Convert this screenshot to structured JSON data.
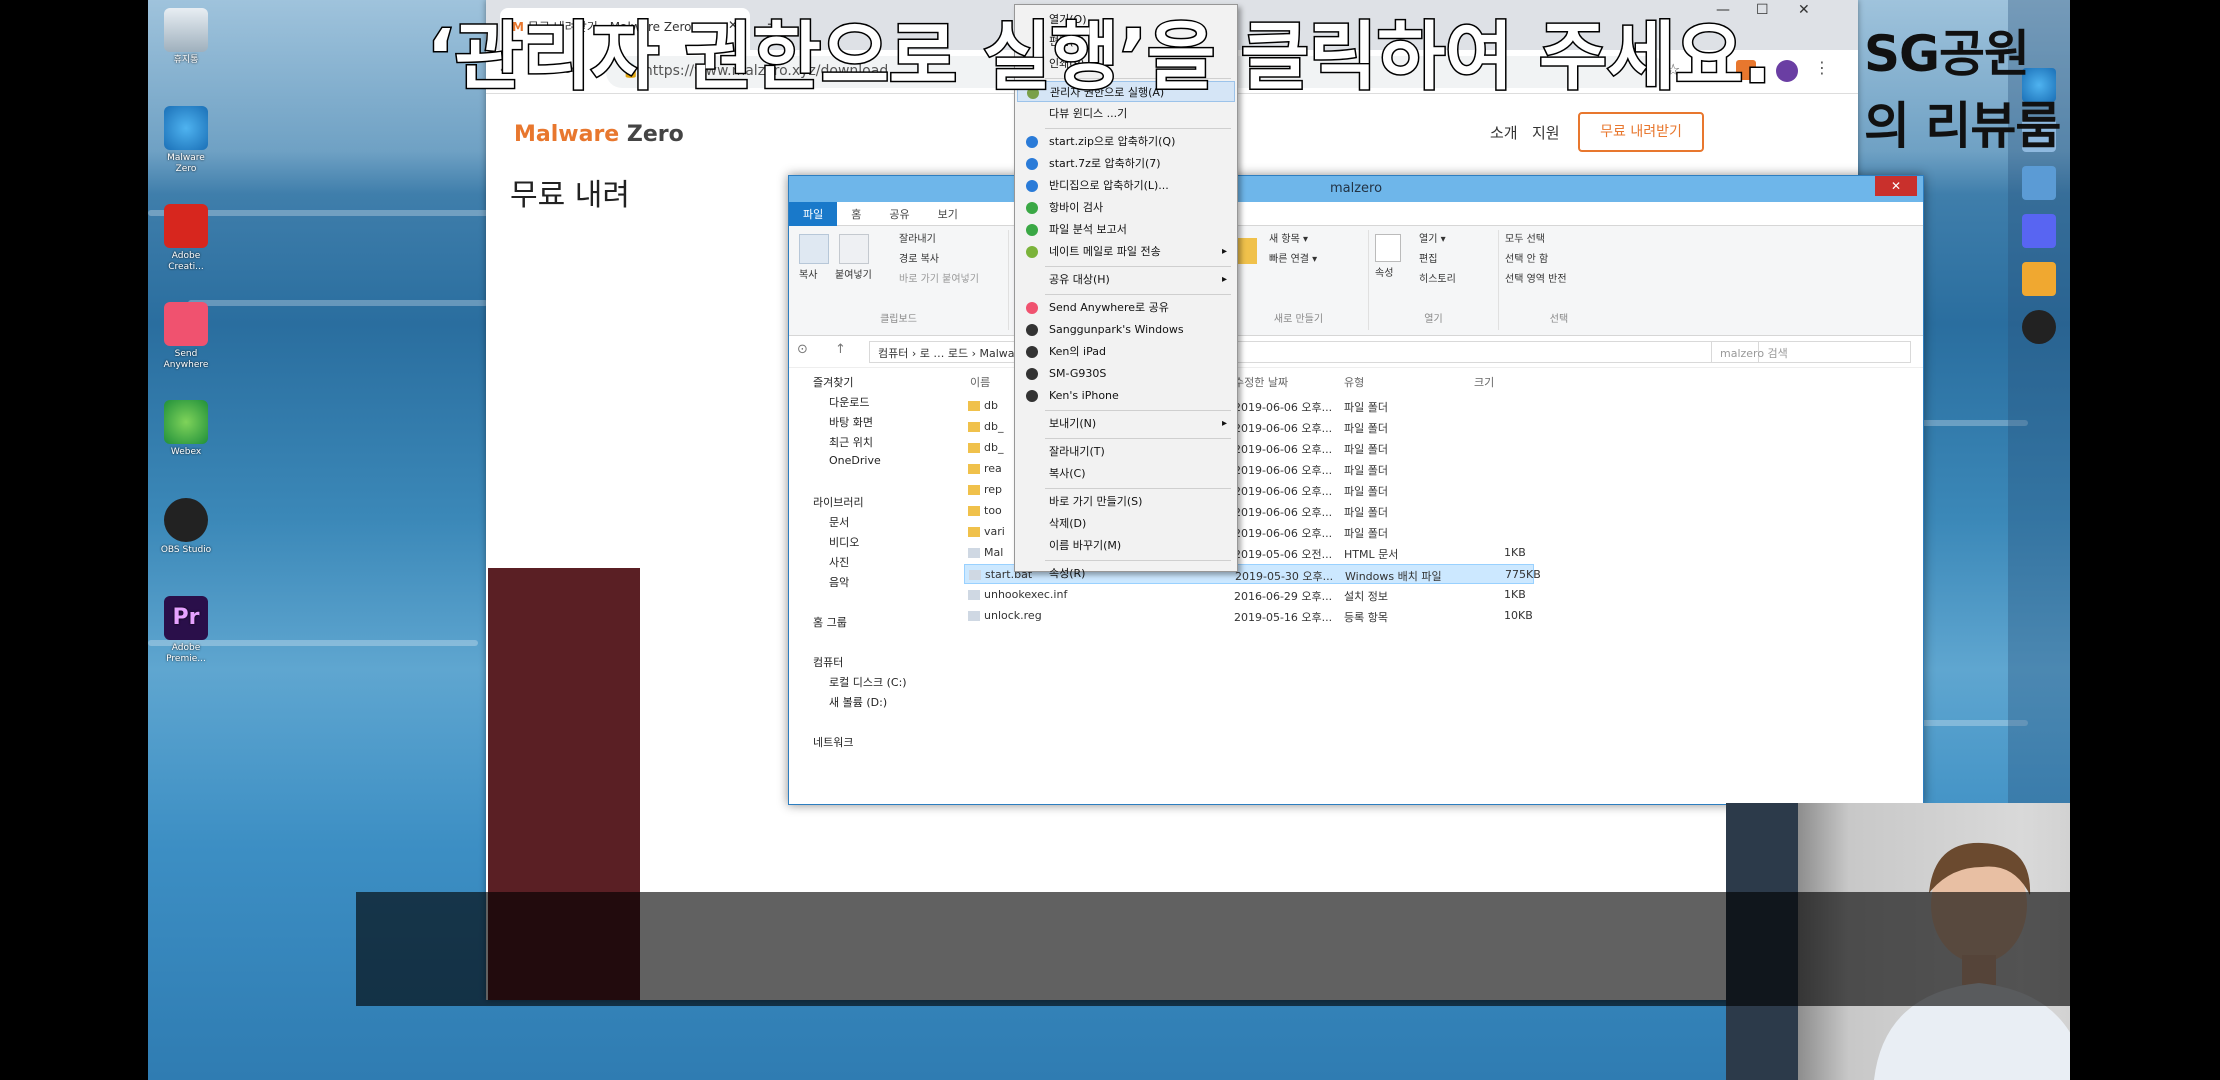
{
  "overlay": {
    "brand": "SG공원의 리뷰룸",
    "caption": "‘관리자 권한으로 실행’을 클릭하여 주세요."
  },
  "desktop": {
    "icons": [
      "휴지통",
      "Malware Zero",
      "Adobe Creati...",
      "Send Anywhere",
      "Webex",
      "OBS Studio",
      "Adobe Premie..."
    ]
  },
  "browser": {
    "tab_title": "무료 내려받기 - Malware Zero",
    "url": "https://www.malzero.xyz/download",
    "logo_a": "Malware",
    "logo_b": "Zero",
    "nav": [
      "소개",
      "지원"
    ],
    "download_button": "무료 내려받기",
    "page_heading": "무료 내려"
  },
  "explorer": {
    "title": "malzero",
    "ribbon_tabs": [
      "파일",
      "홈",
      "공유",
      "보기"
    ],
    "clipboard": {
      "copy": "복사",
      "paste": "붙여넣기",
      "cut": "잘라내기",
      "copy_path": "경로 복사",
      "paste_shortcut": "바로 가기 붙여넣기",
      "caption": "클립보드"
    },
    "new": {
      "new_item": "새 항목 ▾",
      "quick_access": "빠른 연결 ▾",
      "caption": "새로 만들기"
    },
    "open": {
      "properties": "속성",
      "open": "열기 ▾",
      "edit": "편집",
      "history": "히스토리",
      "caption": "열기"
    },
    "select": {
      "all": "모두 선택",
      "none": "선택 안 함",
      "invert": "선택 영역 반전",
      "caption": "선택"
    },
    "breadcrumb": "컴퓨터 › 로 …  로드 › MalwareZero › malzero ›",
    "search_placeholder": "malzero 검색",
    "nav": {
      "favorites": "즐겨찾기",
      "downloads": "다운로드",
      "desktop": "바탕 화면",
      "recent": "최근 위치",
      "onedrive": "OneDrive",
      "libraries": "라이브러리",
      "documents": "문서",
      "videos": "비디오",
      "pictures": "사진",
      "music": "음악",
      "homegroup": "홈 그룹",
      "computer": "컴퓨터",
      "local_disk": "로컬 디스크 (C:)",
      "new_volume": "새 볼륨 (D:)",
      "network": "네트워크"
    },
    "columns": [
      "이름",
      "수정한 날짜",
      "유형",
      "크기"
    ],
    "files": [
      {
        "name": "db",
        "date": "2019-06-06 오후...",
        "type": "파일 폴더",
        "size": ""
      },
      {
        "name": "db_",
        "date": "2019-06-06 오후...",
        "type": "파일 폴더",
        "size": ""
      },
      {
        "name": "db_",
        "date": "2019-06-06 오후...",
        "type": "파일 폴더",
        "size": ""
      },
      {
        "name": "rea",
        "date": "2019-06-06 오후...",
        "type": "파일 폴더",
        "size": ""
      },
      {
        "name": "rep",
        "date": "2019-06-06 오후...",
        "type": "파일 폴더",
        "size": ""
      },
      {
        "name": "too",
        "date": "2019-06-06 오후...",
        "type": "파일 폴더",
        "size": ""
      },
      {
        "name": "vari",
        "date": "2019-06-06 오후...",
        "type": "파일 폴더",
        "size": ""
      },
      {
        "name": "Mal",
        "date": "2019-05-06 오전...",
        "type": "HTML 문서",
        "size": "1KB"
      },
      {
        "name": "start.bat",
        "date": "2019-05-30 오후...",
        "type": "Windows 배치 파일",
        "size": "775KB"
      },
      {
        "name": "unhookexec.inf",
        "date": "2016-06-29 오후...",
        "type": "설치 정보",
        "size": "1KB"
      },
      {
        "name": "unlock.reg",
        "date": "2019-05-16 오후...",
        "type": "등록 항목",
        "size": "10KB"
      }
    ]
  },
  "context_menu": {
    "items": [
      {
        "label": "열기(O)"
      },
      {
        "label": "편집(E)"
      },
      {
        "label": "인쇄(P)"
      },
      {
        "label": "관리자 권한으로 실행(A)",
        "highlighted": true
      },
      {
        "label": "다뷰 윈디스 ...기"
      },
      {
        "label": "start.zip으로 압축하기(Q)"
      },
      {
        "label": "start.7z로 압축하기(7)"
      },
      {
        "label": "반디집으로 압축하기(L)..."
      },
      {
        "label": "항바이 검사"
      },
      {
        "label": "파일 분석 보고서"
      },
      {
        "label": "네이트 메일로 파일 전송",
        "submenu": true
      },
      {
        "label": "공유 대상(H)",
        "submenu": true
      },
      {
        "label": "Send Anywhere로 공유"
      },
      {
        "label": "Sanggunpark's Windows"
      },
      {
        "label": "Ken의 iPad"
      },
      {
        "label": "SM-G930S"
      },
      {
        "label": "Ken's iPhone"
      },
      {
        "label": "보내기(N)",
        "submenu": true
      },
      {
        "label": "잘라내기(T)"
      },
      {
        "label": "복사(C)"
      },
      {
        "label": "바로 가기 만들기(S)"
      },
      {
        "label": "삭제(D)"
      },
      {
        "label": "이름 바꾸기(M)"
      },
      {
        "label": "속성(R)"
      }
    ]
  },
  "colors": {
    "accent": "#e8772e",
    "explorer_blue": "#1979ca",
    "menu_highlight": "#d5e5f6"
  }
}
